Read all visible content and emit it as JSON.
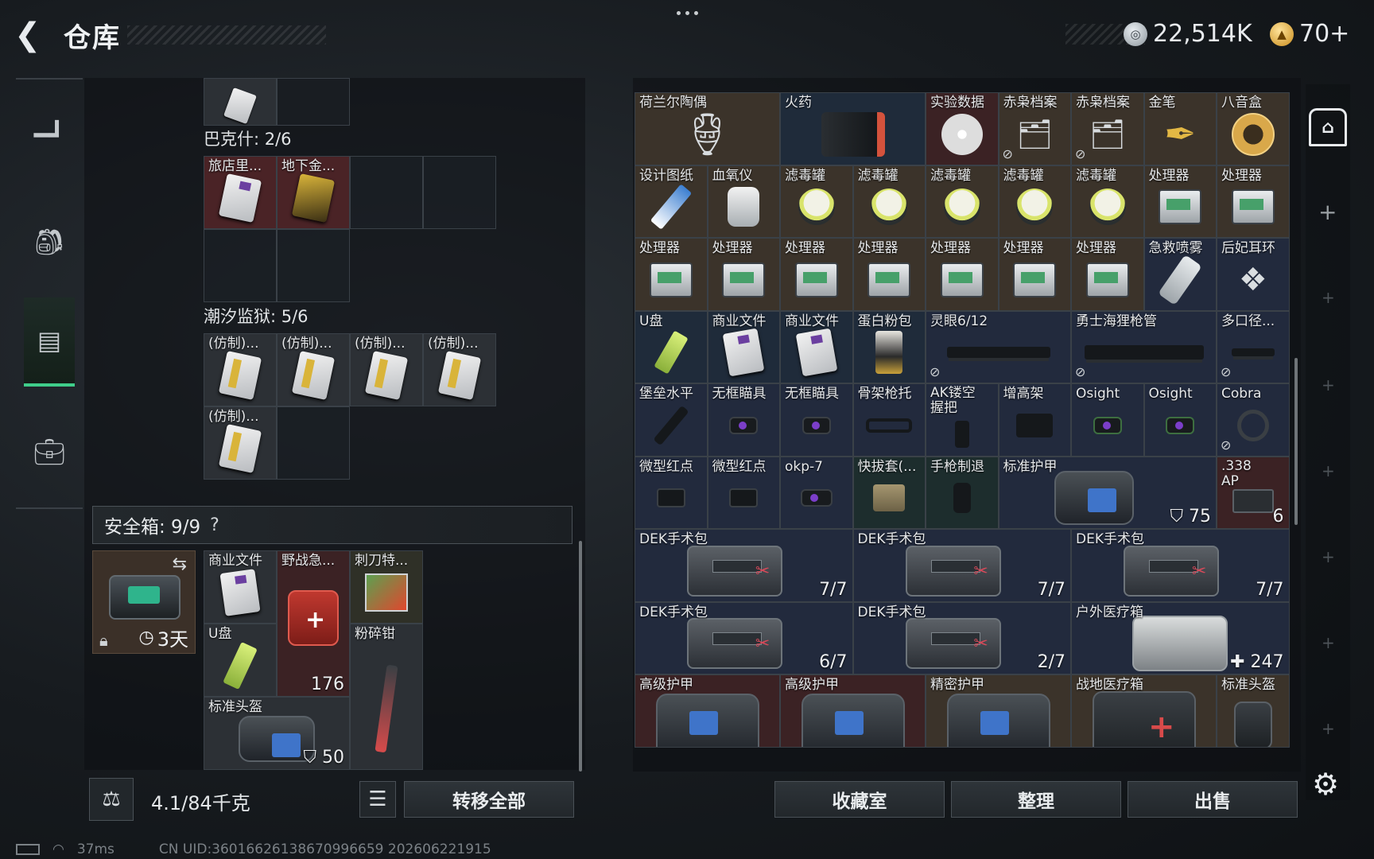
{
  "header": {
    "back_icon": "back-arrow-icon",
    "title": "仓库",
    "currency1_value": "22,514K",
    "currency2_value": "70+",
    "currency1_icon": "silver-coin-icon",
    "currency2_icon": "gold-coin-icon"
  },
  "nav": {
    "items": [
      "pistol-icon",
      "backpack-icon",
      "storage-locker-icon",
      "briefcase-icon"
    ],
    "active_index": 2,
    "accent": "#3fce8a"
  },
  "left": {
    "sections": [
      {
        "title": "巴克什: 2/6",
        "items": [
          "旅店里...",
          "地下金..."
        ]
      },
      {
        "title": "潮汐监狱: 5/6",
        "items": [
          "(仿制)...",
          "(仿制)...",
          "(仿制)...",
          "(仿制)...",
          "(仿制)..."
        ]
      }
    ],
    "safebox": {
      "label": "安全箱: 9/9",
      "help": "?",
      "duration": "3天",
      "items": [
        {
          "name": "商业文件",
          "count": ""
        },
        {
          "name": "野战急...",
          "count": "176"
        },
        {
          "name": "刺刀特...",
          "count": ""
        },
        {
          "name": "U盘",
          "count": ""
        },
        {
          "name": "粉碎钳",
          "count": ""
        },
        {
          "name": "标准头盔",
          "count": "50"
        }
      ]
    },
    "weight": "4.1/84千克",
    "transfer_all": "转移全部"
  },
  "right": {
    "rows": [
      [
        "荷兰尔陶偶",
        "火药",
        "实验数据",
        "赤枭档案",
        "赤枭档案",
        "金笔",
        "八音盒"
      ],
      [
        "设计图纸",
        "血氧仪",
        "滤毒罐",
        "滤毒罐",
        "滤毒罐",
        "滤毒罐",
        "滤毒罐",
        "处理器",
        "处理器"
      ],
      [
        "处理器",
        "处理器",
        "处理器",
        "处理器",
        "处理器",
        "处理器",
        "处理器",
        "急救喷雾",
        "后妃耳环"
      ],
      [
        "U盘",
        "商业文件",
        "商业文件",
        "蛋白粉包",
        "灵眼6/12",
        "勇士海狸枪管",
        "多口径..."
      ],
      [
        "堡垒水平",
        "无框瞄具",
        "无框瞄具",
        "骨架枪托",
        "AK镂空握把",
        "增高架",
        "Osight",
        "Osight",
        "Cobra"
      ],
      [
        "微型红点",
        "微型红点",
        "okp-7",
        "快拔套(...",
        "手枪制退",
        "标准护甲",
        ".338 AP"
      ]
    ],
    "armor_durability": "75",
    "ammo_count": "6",
    "kits": [
      {
        "name": "DEK手术包",
        "count": "7/7"
      },
      {
        "name": "DEK手术包",
        "count": "7/7"
      },
      {
        "name": "DEK手术包",
        "count": "7/7"
      },
      {
        "name": "DEK手术包",
        "count": "6/7"
      },
      {
        "name": "DEK手术包",
        "count": "2/7"
      },
      {
        "name": "户外医疗箱",
        "count": "247"
      }
    ],
    "bottom_row": [
      "高级护甲",
      "高级护甲",
      "精密护甲",
      "战地医疗箱",
      "标准头盔"
    ],
    "buttons": [
      "收藏室",
      "整理",
      "出售"
    ]
  },
  "status": {
    "ping": "37ms",
    "uid": "CN UID:3601662613867099665​9 202606221915"
  }
}
